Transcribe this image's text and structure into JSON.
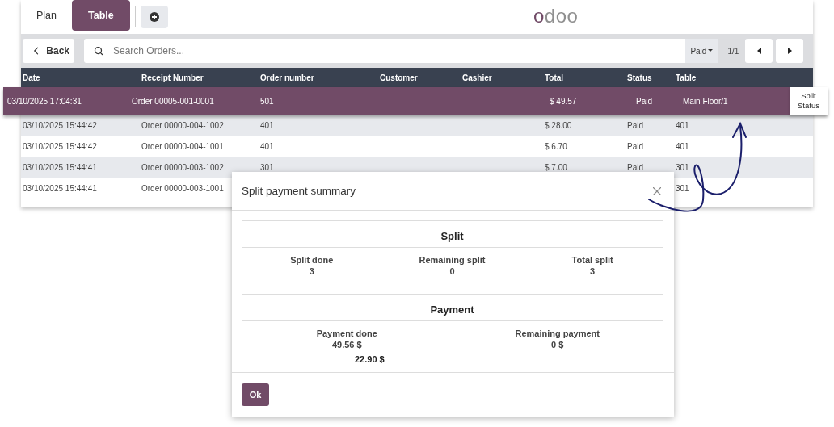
{
  "top_bar": {
    "tabs": [
      {
        "label": "Plan",
        "selected": false
      },
      {
        "label": "Table",
        "selected": true
      }
    ],
    "logo": "odoo"
  },
  "controls": {
    "back": "Back",
    "search": {
      "placeholder": "Search Orders..."
    },
    "filter": "Paid",
    "pager": "1/1"
  },
  "table": {
    "columns": [
      "Date",
      "Receipt Number",
      "Order number",
      "Customer",
      "Cashier",
      "Total",
      "Status",
      "Table"
    ],
    "rows": [
      {
        "date": "03/10/2025 17:04:31",
        "receipt": "Order 00005-001-0001",
        "order_number": "501",
        "total": "$ 49.57",
        "status": "Paid",
        "table": "Main Floor/1",
        "selected": true,
        "action": "Split Status"
      },
      {
        "date": "03/10/2025 15:44:42",
        "receipt": "Order 00000-004-1002",
        "order_number": "401",
        "total": "$ 28.00",
        "status": "Paid",
        "table": "401",
        "selected": false
      },
      {
        "date": "03/10/2025 15:44:42",
        "receipt": "Order 00000-004-1001",
        "order_number": "401",
        "total": "$ 6.70",
        "status": "Paid",
        "table": "401",
        "selected": false
      },
      {
        "date": "03/10/2025 15:44:41",
        "receipt": "Order 00000-003-1002",
        "order_number": "301",
        "total": "$ 7.00",
        "status": "Paid",
        "table": "301",
        "selected": false
      },
      {
        "date": "03/10/2025 15:44:41",
        "receipt": "Order 00000-003-1001",
        "table": "301",
        "selected": false
      }
    ]
  },
  "dialog": {
    "title": "Split payment summary",
    "sections": [
      {
        "heading": "Split",
        "stats": [
          {
            "label": "Split done",
            "value": "3"
          },
          {
            "label": "Remaining split",
            "value": "0"
          },
          {
            "label": "Total split",
            "value": "3"
          }
        ]
      },
      {
        "heading": "Payment",
        "stats": [
          {
            "label": "Payment done",
            "value": "49.56 $"
          },
          {
            "label": "Remaining payment",
            "value": "0 $"
          }
        ]
      }
    ],
    "extra_amount": "22.90 $",
    "ok": "Ok"
  }
}
